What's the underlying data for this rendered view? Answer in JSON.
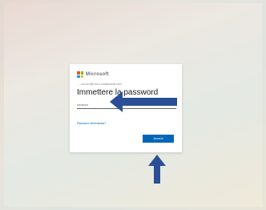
{
  "colors": {
    "accent": "#0067b8",
    "arrow": "#2b4f96"
  },
  "login": {
    "brand": "Microsoft",
    "back_text": "← ••••••••••@•••••••.onmicrosoft.com",
    "heading": "Immettere la password",
    "password_value": "••••••••••",
    "forgot_text": "Password dimenticata?",
    "signin_label": "Accedi"
  },
  "icons": {
    "logo": "microsoft-logo-icon",
    "arrow_left": "arrow-left-icon",
    "arrow_up": "arrow-up-icon"
  }
}
